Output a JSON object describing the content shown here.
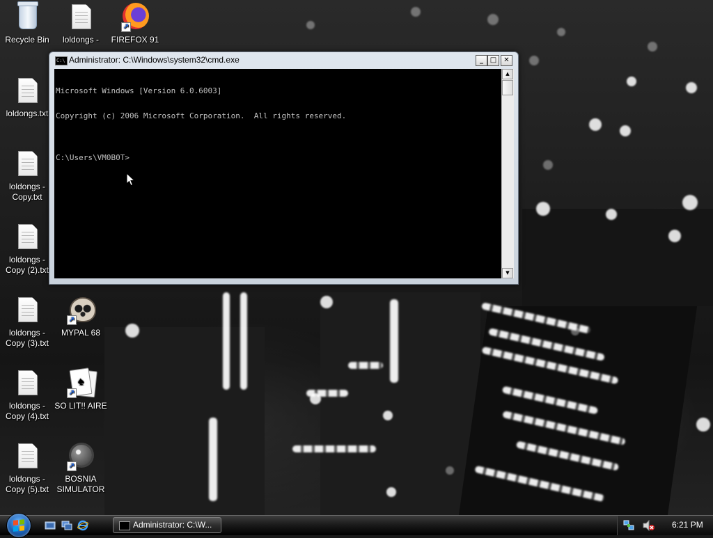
{
  "desktop": {
    "icons": [
      {
        "label": "Recycle Bin",
        "icon": "recycle-bin-icon"
      },
      {
        "label": "loldongs -",
        "icon": "text-file-icon"
      },
      {
        "label": "FIREFOX 91",
        "icon": "firefox-icon"
      },
      {
        "label": "loldongs.txt",
        "icon": "text-file-icon"
      },
      {
        "label": "loldongs - Copy.txt",
        "icon": "text-file-icon"
      },
      {
        "label": "loldongs - Copy (2).txt",
        "icon": "text-file-icon"
      },
      {
        "label": "loldongs - Copy (3).txt",
        "icon": "text-file-icon"
      },
      {
        "label": "MYPAL 68",
        "icon": "mypal-icon"
      },
      {
        "label": "loldongs - Copy (4).txt",
        "icon": "text-file-icon"
      },
      {
        "label": "SO LIT!! AIRE",
        "icon": "solitaire-icon"
      },
      {
        "label": "loldongs - Copy (5).txt",
        "icon": "text-file-icon"
      },
      {
        "label": "BOSNIA SIMULATOR",
        "icon": "minesweeper-icon"
      }
    ]
  },
  "cmd_window": {
    "title": "Administrator: C:\\Windows\\system32\\cmd.exe",
    "controls": {
      "minimize": "_",
      "maximize": "□",
      "close": "✕"
    },
    "console_lines": [
      "Microsoft Windows [Version 6.0.6003]",
      "Copyright (c) 2006 Microsoft Corporation.  All rights reserved.",
      "",
      "C:\\Users\\VM0B0T>"
    ]
  },
  "taskbar": {
    "quick_launch": [
      "show-desktop-icon",
      "switch-windows-icon",
      "internet-explorer-icon"
    ],
    "tasks": [
      {
        "label": "Administrator: C:\\W...",
        "icon": "cmd-icon"
      }
    ],
    "tray_icons": [
      "network-icon",
      "volume-muted-icon"
    ],
    "clock": "6:21 PM"
  },
  "colors": {
    "console_bg": "#000000",
    "console_fg": "#c0c0c0",
    "taskbar": "#1b1b1b",
    "window_frame": "#d4dbe3"
  }
}
